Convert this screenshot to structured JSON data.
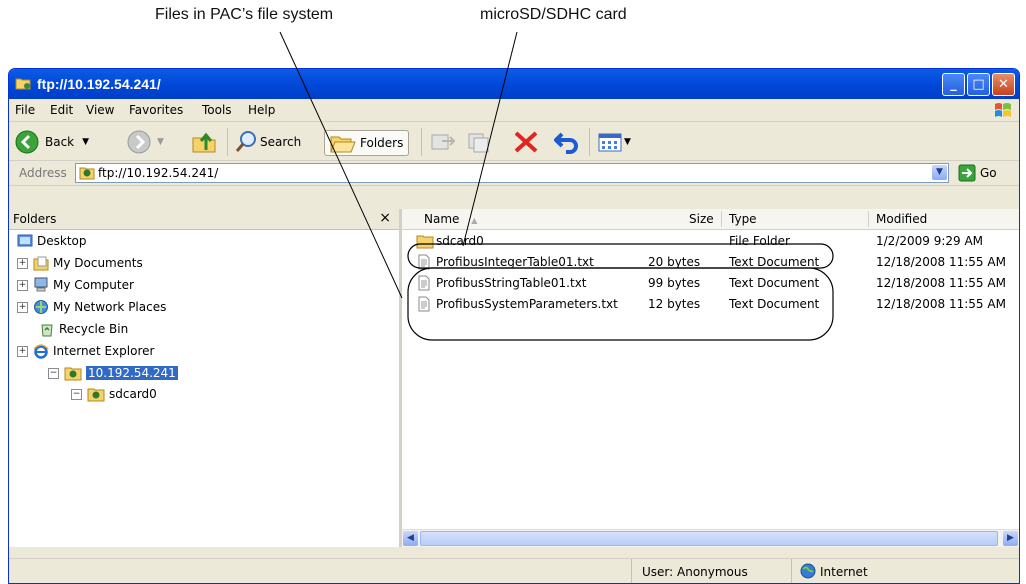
{
  "annotations": {
    "files_callout": "Files in PAC’s file system",
    "card_callout": "microSD/SDHC card"
  },
  "window": {
    "title": "ftp://10.192.54.241/",
    "menu": [
      "File",
      "Edit",
      "View",
      "Favorites",
      "Tools",
      "Help"
    ]
  },
  "toolbar": {
    "back_label": "Back",
    "search_label": "Search",
    "folders_label": "Folders"
  },
  "address": {
    "label": "Address",
    "value": "ftp://10.192.54.241/",
    "go_label": "Go"
  },
  "folders_pane": {
    "header": "Folders",
    "close_glyph": "×",
    "tree": [
      {
        "label": "Desktop",
        "icon": "desktop-icon",
        "expander": ""
      },
      {
        "label": "My Documents",
        "icon": "documents-folder-icon",
        "expander": "+"
      },
      {
        "label": "My Computer",
        "icon": "computer-icon",
        "expander": "+"
      },
      {
        "label": "My Network Places",
        "icon": "network-places-icon",
        "expander": "+"
      },
      {
        "label": "Recycle Bin",
        "icon": "recycle-bin-icon",
        "expander": ""
      },
      {
        "label": "Internet Explorer",
        "icon": "internet-explorer-icon",
        "expander": "+"
      },
      {
        "label": "10.192.54.241",
        "icon": "ftp-site-icon",
        "expander": "−",
        "selected": true
      },
      {
        "label": "sdcard0",
        "icon": "ftp-folder-icon",
        "expander": "−"
      }
    ]
  },
  "file_list": {
    "columns": {
      "name": "Name",
      "size": "Size",
      "type": "Type",
      "modified": "Modified"
    },
    "sort_glyph": "▲",
    "rows": [
      {
        "name": "sdcard0",
        "size": "",
        "type": "File Folder",
        "modified": "1/2/2009 9:29 AM",
        "icon": "folder-icon"
      },
      {
        "name": "ProfibusIntegerTable01.txt",
        "size": "20 bytes",
        "type": "Text Document",
        "modified": "12/18/2008 11:55 AM",
        "icon": "text-file-icon"
      },
      {
        "name": "ProfibusStringTable01.txt",
        "size": "99 bytes",
        "type": "Text Document",
        "modified": "12/18/2008 11:55 AM",
        "icon": "text-file-icon"
      },
      {
        "name": "ProfibusSystemParameters.txt",
        "size": "12 bytes",
        "type": "Text Document",
        "modified": "12/18/2008 11:55 AM",
        "icon": "text-file-icon"
      }
    ]
  },
  "status": {
    "user": "User: Anonymous",
    "zone": "Internet"
  }
}
